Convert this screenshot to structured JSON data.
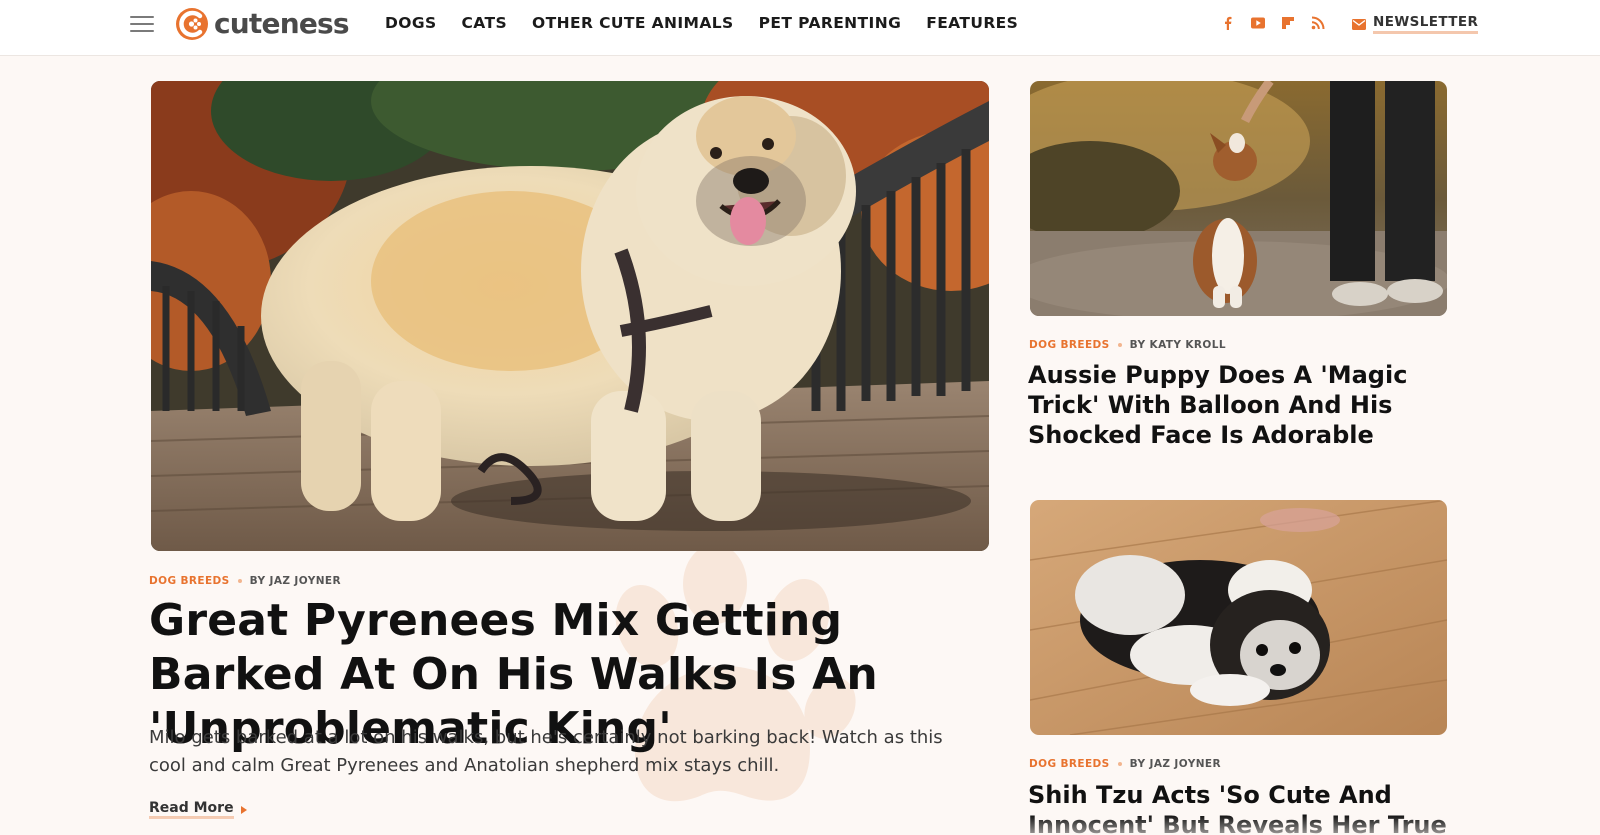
{
  "brand": {
    "name": "cuteness",
    "accent": "#e8732f",
    "underline": "#f4c7ad"
  },
  "nav": {
    "items": [
      {
        "label": "DOGS"
      },
      {
        "label": "CATS"
      },
      {
        "label": "OTHER CUTE ANIMALS"
      },
      {
        "label": "PET PARENTING"
      },
      {
        "label": "FEATURES"
      }
    ]
  },
  "social_icons": [
    "facebook-icon",
    "youtube-icon",
    "flipboard-icon",
    "rss-icon"
  ],
  "newsletter": {
    "label": "NEWSLETTER",
    "icon": "mail-icon"
  },
  "lead": {
    "category": "DOG BREEDS",
    "byline": "BY JAZ JOYNER",
    "title": "Great Pyrenees Mix Getting Barked At On His Walks Is An 'Unproblematic King'",
    "dek": "Milo gets barked at a lot on his walks, but he's certainly not barking back! Watch as this cool and calm Great Pyrenees and Anatolian shepherd mix stays chill.",
    "read_more": "Read More"
  },
  "side": [
    {
      "category": "DOG BREEDS",
      "byline": "BY KATY KROLL",
      "title": "Aussie Puppy Does A 'Magic Trick' With Balloon And His Shocked Face Is Adorable"
    },
    {
      "category": "DOG BREEDS",
      "byline": "BY JAZ JOYNER",
      "title": "Shih Tzu Acts 'So Cute And Innocent' But Reveals Her True Self When She"
    }
  ]
}
